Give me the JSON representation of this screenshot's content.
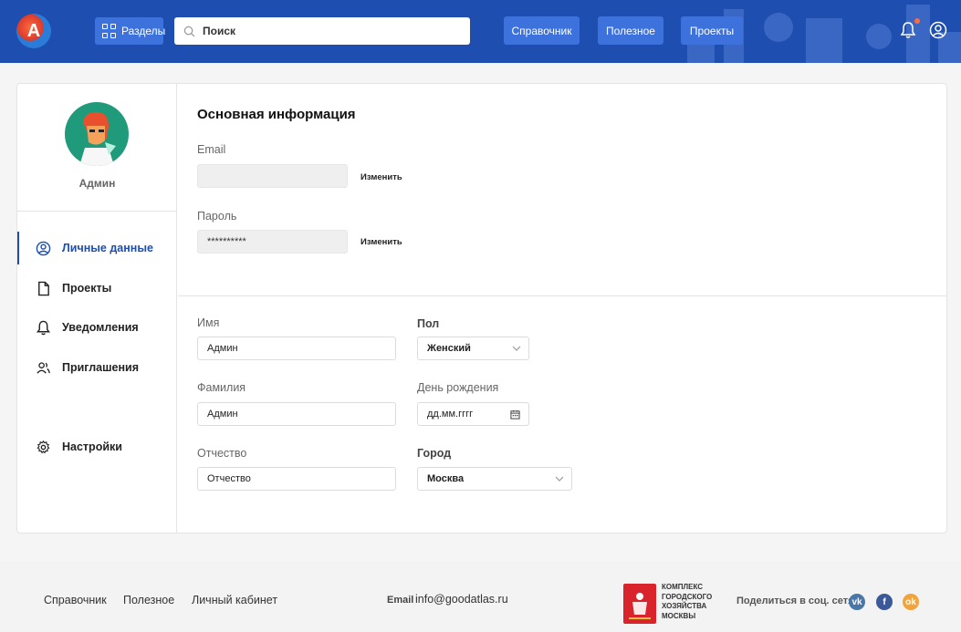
{
  "header": {
    "logo_letter": "A",
    "sections_label": "Разделы",
    "search_placeholder": "Поиск",
    "nav": [
      "Справочник",
      "Полезное",
      "Проекты"
    ]
  },
  "profile": {
    "name": "Админ",
    "menu": [
      {
        "label": "Личные данные",
        "icon": "user-circle-icon",
        "active": true
      },
      {
        "label": "Проекты",
        "icon": "document-icon",
        "active": false
      },
      {
        "label": "Уведомления",
        "icon": "bell-icon",
        "active": false
      },
      {
        "label": "Приглашения",
        "icon": "users-icon",
        "active": false
      },
      {
        "label": "Настройки",
        "icon": "gear-icon",
        "active": false
      }
    ]
  },
  "main": {
    "title": "Основная информация",
    "email_label": "Email",
    "email_value": "",
    "password_label": "Пароль",
    "password_value": "**********",
    "change_label": "Изменить",
    "first_name_label": "Имя",
    "first_name_value": "Админ",
    "last_name_label": "Фамилия",
    "last_name_value": "Админ",
    "patronymic_label": "Отчество",
    "patronymic_placeholder": "Отчество",
    "gender_label": "Пол",
    "gender_value": "Женский",
    "birthday_label": "День рождения",
    "birthday_placeholder": "дд.мм.гггг",
    "city_label": "Город",
    "city_value": "Москва"
  },
  "footer": {
    "links": [
      "Справочник",
      "Полезное",
      "Личный кабинет"
    ],
    "email_label": "Email",
    "email": "info@goodatlas.ru",
    "complex_text": "КОМПЛЕКС ГОРОДСКОГО ХОЗЯЙСТВА МОСКВЫ",
    "share_label": "Поделиться в соц. сетях",
    "social": [
      {
        "icon": "vk-icon",
        "glyph": "vk",
        "color": "#4a76a8"
      },
      {
        "icon": "facebook-icon",
        "glyph": "f",
        "color": "#3b5998"
      },
      {
        "icon": "odnoklassniki-icon",
        "glyph": "ok",
        "color": "#f2a33a"
      }
    ]
  },
  "colors": {
    "header_bg": "#1e4eb0",
    "button_bg": "#3d72dc",
    "accent": "#1e4eb0",
    "notification_dot": "#ff6a3d"
  }
}
